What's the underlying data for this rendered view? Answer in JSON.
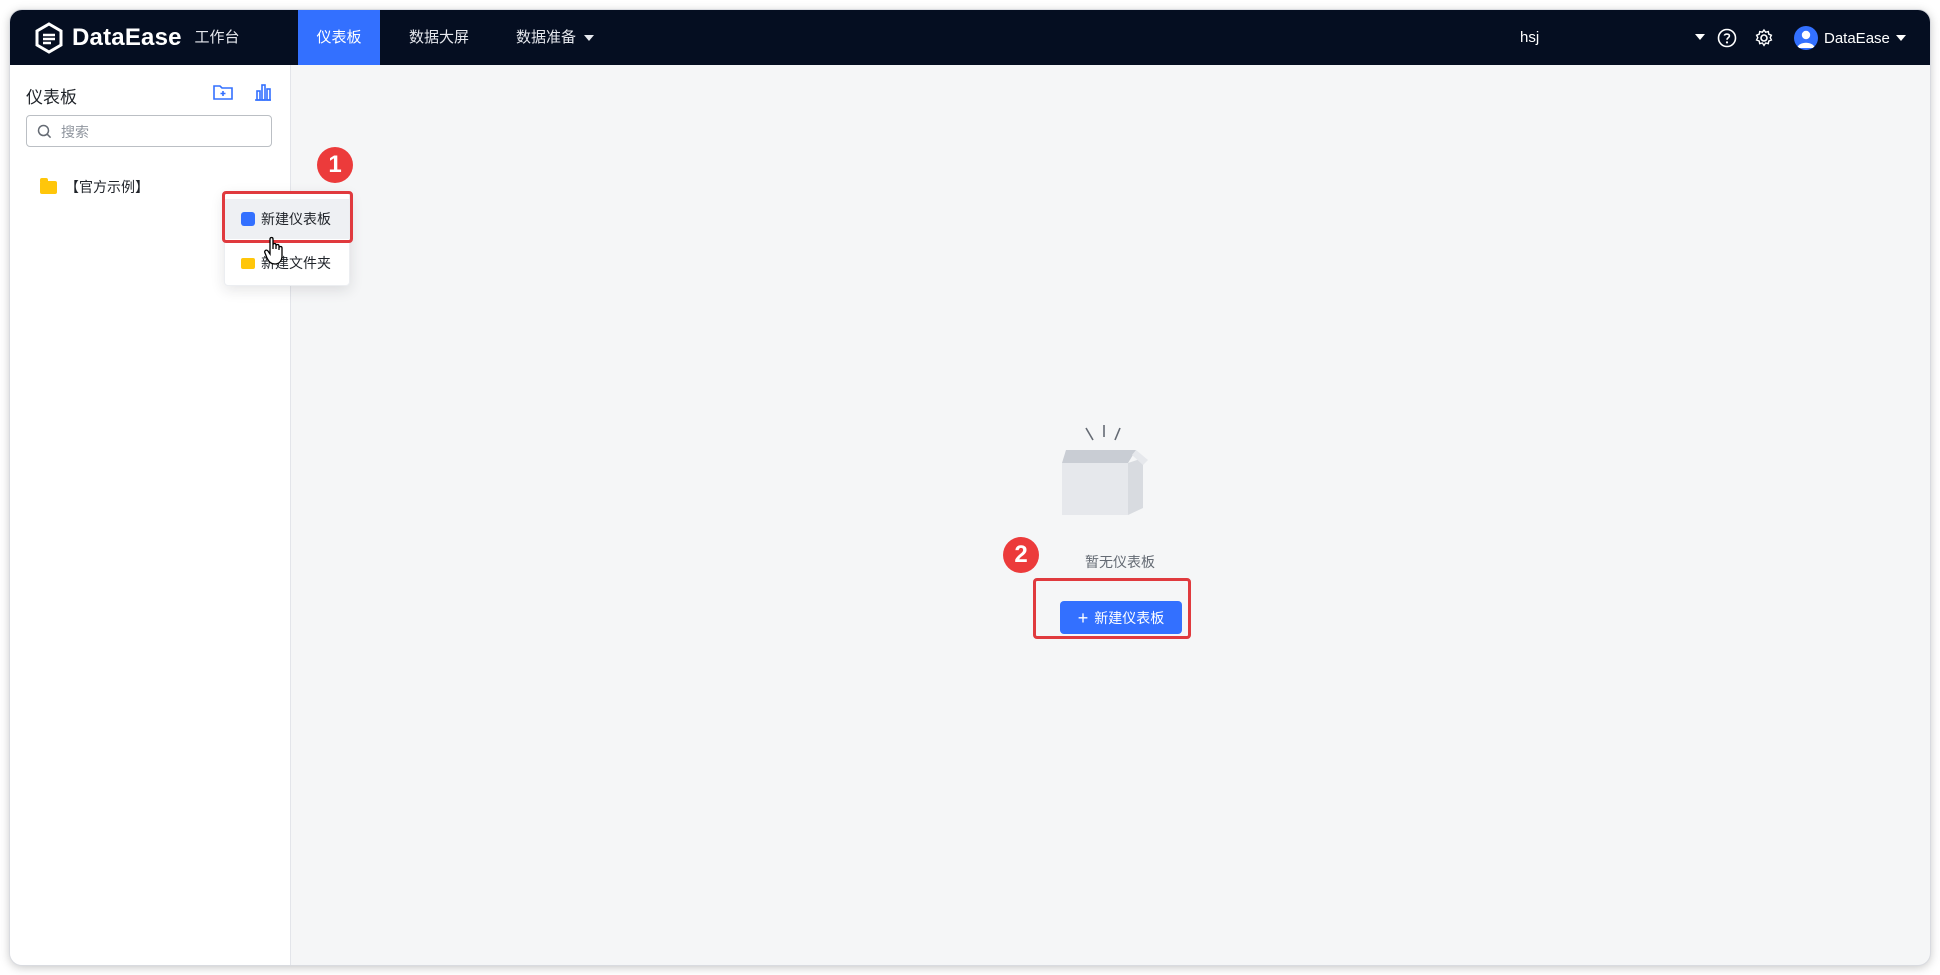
{
  "app": {
    "name": "DataEase"
  },
  "nav": {
    "items": [
      {
        "label": "工作台"
      },
      {
        "label": "仪表板"
      },
      {
        "label": "数据大屏"
      },
      {
        "label": "数据准备"
      }
    ]
  },
  "header": {
    "workspace": "hsj",
    "user": "DataEase"
  },
  "sidebar": {
    "title": "仪表板",
    "search_placeholder": "搜索",
    "tree": [
      {
        "label": "【官方示例】"
      }
    ]
  },
  "menu": {
    "items": [
      {
        "label": "新建仪表板"
      },
      {
        "label": "新建文件夹"
      }
    ]
  },
  "annotations": {
    "step1": "1",
    "step2": "2"
  },
  "empty": {
    "text": "暂无仪表板",
    "button_label": "新建仪表板"
  },
  "colors": {
    "topbar": "#050e21",
    "accent": "#3370ff",
    "highlight": "#e03a3e",
    "badge": "#ec3b3b",
    "folder": "#ffc60a"
  }
}
